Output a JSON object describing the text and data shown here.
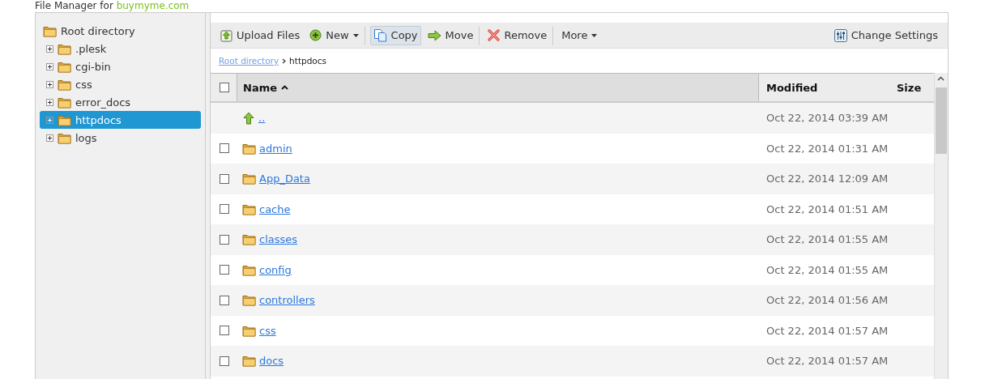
{
  "page_title": {
    "text": "File Manager for ",
    "domain": "buymyme.com"
  },
  "tree": {
    "root": "Root directory",
    "items": [
      {
        "label": ".plesk",
        "expanded": false,
        "selected": false
      },
      {
        "label": "cgi-bin",
        "expanded": false,
        "selected": false
      },
      {
        "label": "css",
        "expanded": false,
        "selected": false
      },
      {
        "label": "error_docs",
        "expanded": false,
        "selected": false
      },
      {
        "label": "httpdocs",
        "expanded": false,
        "selected": true
      },
      {
        "label": "logs",
        "expanded": false,
        "selected": false
      }
    ]
  },
  "toolbar": {
    "buttons": [
      {
        "label": "Upload Files",
        "kind": "upload",
        "dropdown": false,
        "active": false,
        "separator_after": false
      },
      {
        "label": "New",
        "kind": "new",
        "dropdown": true,
        "active": false,
        "separator_after": true
      },
      {
        "label": "Copy",
        "kind": "copy",
        "dropdown": false,
        "active": true,
        "separator_after": false
      },
      {
        "label": "Move",
        "kind": "move",
        "dropdown": false,
        "active": false,
        "separator_after": true
      },
      {
        "label": "Remove",
        "kind": "remove",
        "dropdown": false,
        "active": false,
        "separator_after": true
      },
      {
        "label": "More",
        "kind": "more",
        "dropdown": true,
        "active": false,
        "separator_after": false
      }
    ],
    "settings": "Change Settings"
  },
  "breadcrumb": [
    {
      "label": "Root directory",
      "kind": "link"
    },
    {
      "label": "httpdocs",
      "kind": "current"
    }
  ],
  "table": {
    "columns": [
      {
        "label": "Name",
        "sorted": true
      },
      {
        "label": "Modified",
        "sorted": false
      },
      {
        "label": "Size",
        "sorted": false
      }
    ],
    "header_checked": false,
    "rows": [
      {
        "kind": "parent",
        "name": "..",
        "modified": "Oct 22, 2014 03:39 AM"
      },
      {
        "kind": "folder",
        "name": "admin",
        "modified": "Oct 22, 2014 01:31 AM",
        "checked": false
      },
      {
        "kind": "folder",
        "name": "App_Data",
        "modified": "Oct 22, 2014 12:09 AM",
        "checked": false
      },
      {
        "kind": "folder",
        "name": "cache",
        "modified": "Oct 22, 2014 01:51 AM",
        "checked": false
      },
      {
        "kind": "folder",
        "name": "classes",
        "modified": "Oct 22, 2014 01:55 AM",
        "checked": false
      },
      {
        "kind": "folder",
        "name": "config",
        "modified": "Oct 22, 2014 01:55 AM",
        "checked": false
      },
      {
        "kind": "folder",
        "name": "controllers",
        "modified": "Oct 22, 2014 01:56 AM",
        "checked": false
      },
      {
        "kind": "folder",
        "name": "css",
        "modified": "Oct 22, 2014 01:57 AM",
        "checked": false
      },
      {
        "kind": "folder",
        "name": "docs",
        "modified": "Oct 22, 2014 01:57 AM",
        "checked": false
      }
    ]
  }
}
